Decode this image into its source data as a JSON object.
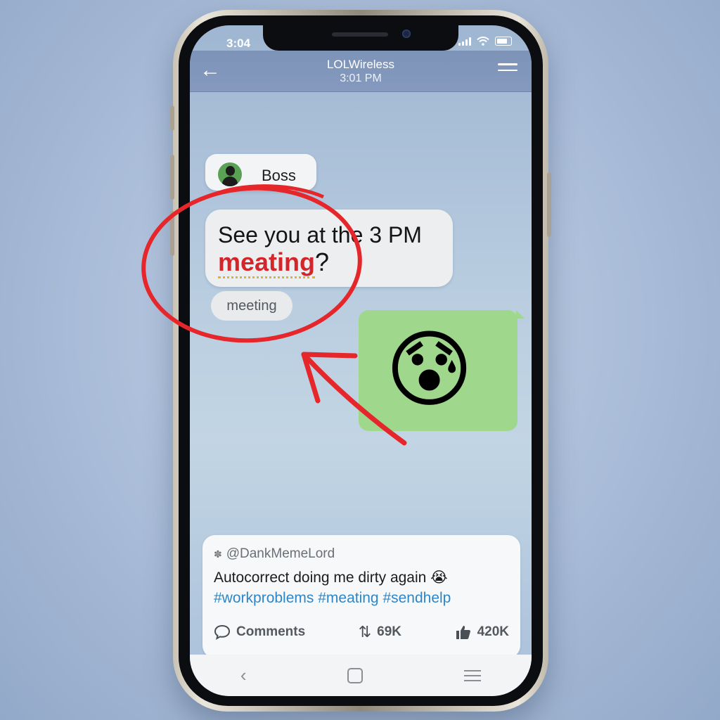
{
  "status_bar": {
    "time": "3:04"
  },
  "header": {
    "title": "LOLWireless",
    "subtitle": "3:01 PM"
  },
  "thread": {
    "sender": "Boss",
    "message": {
      "before": "See you at the 3 PM",
      "typo": "meating",
      "after": "?"
    },
    "suggestion": "meeting",
    "reply_emoji": "😰"
  },
  "post": {
    "user": "@DankMemeLord",
    "text": "Autocorrect doing me dirty again 😭",
    "hashtags": "#workproblems #meating #sendhelp",
    "actions": {
      "comments": "Comments",
      "reposts": "69K",
      "likes": "420K"
    }
  },
  "icons": {
    "back": "arrow-left-icon",
    "menu": "menu-icon",
    "comment": "comment-icon",
    "repost": "repost-icon",
    "like": "thumbs-up-icon",
    "nav_back": "chevron-left-icon",
    "nav_home": "home-square-icon",
    "nav_recent": "recent-apps-icon"
  },
  "colors": {
    "annotation": "#e5262a",
    "bubble_green": "#9fd88d",
    "hashtag": "#2f86c6"
  }
}
